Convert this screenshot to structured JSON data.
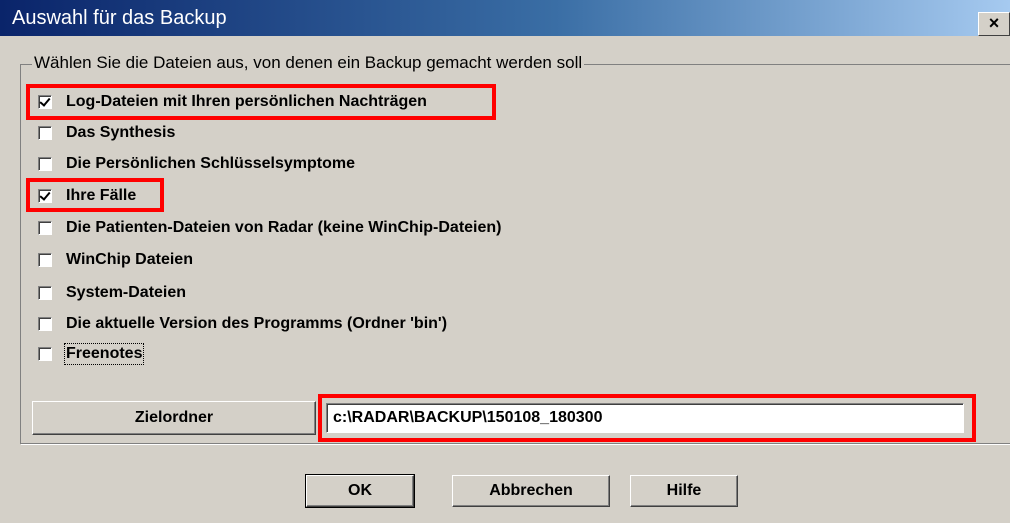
{
  "window": {
    "title": "Auswahl für das Backup",
    "close_label": "×"
  },
  "group": {
    "legend": "Wählen Sie die Dateien aus, von denen ein Backup gemacht werden soll"
  },
  "checkboxes": [
    {
      "label": "Log-Dateien mit Ihren persönlichen Nachträgen",
      "checked": true
    },
    {
      "label": "Das Synthesis",
      "checked": false
    },
    {
      "label": "Die Persönlichen Schlüsselsymptome",
      "checked": false
    },
    {
      "label": "Ihre Fälle",
      "checked": true
    },
    {
      "label": "Die  Patienten-Dateien von Radar (keine WinChip-Dateien)",
      "checked": false
    },
    {
      "label": "WinChip Dateien",
      "checked": false
    },
    {
      "label": "System-Dateien",
      "checked": false
    },
    {
      "label": "Die aktuelle Version des Programms (Ordner 'bin')",
      "checked": false
    },
    {
      "label": "Freenotes",
      "checked": false
    }
  ],
  "target": {
    "button_label": "Zielordner",
    "path_value": "c:\\RADAR\\BACKUP\\150108_180300"
  },
  "footer": {
    "ok_label": "OK",
    "cancel_label": "Abbrechen",
    "help_label": "Hilfe"
  },
  "colors": {
    "face": "#d4d0c8",
    "title_start": "#0a246a",
    "title_end": "#a6caf0",
    "highlight": "#ff0000"
  }
}
